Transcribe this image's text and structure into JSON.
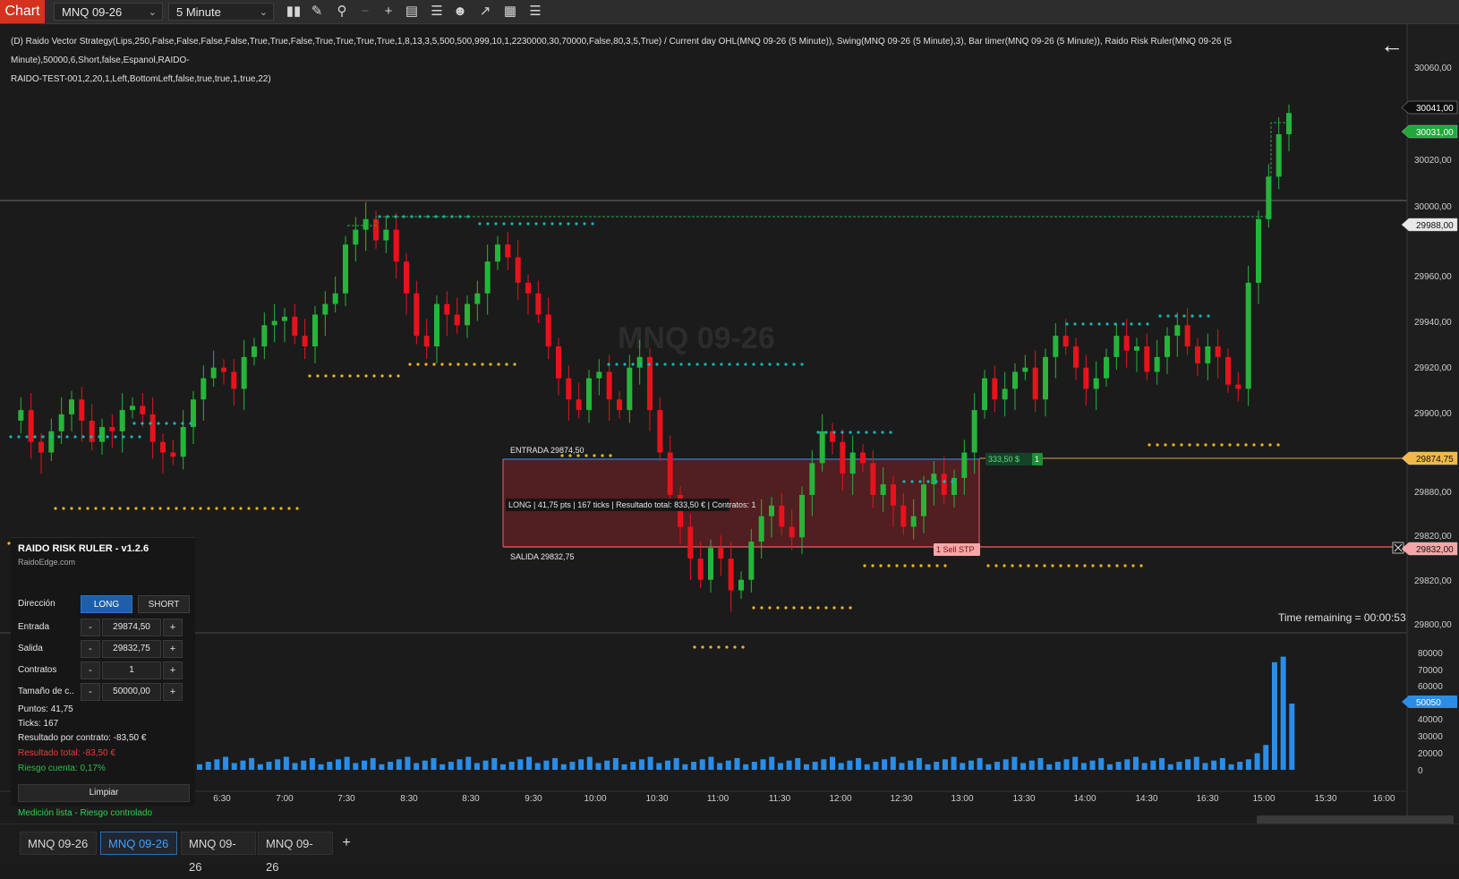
{
  "toolbar": {
    "chart_label": "Chart",
    "instrument": "MNQ 09-26",
    "interval": "5 Minute",
    "icons": [
      "bar-style-icon",
      "draw-pencil-icon",
      "zoom-icon",
      "line-icon",
      "crosshair-icon",
      "data-box-icon",
      "strategy-icon",
      "people-icon",
      "indicator-icon",
      "properties-icon",
      "list-icon"
    ]
  },
  "chart": {
    "indicator_line1": "(D) Raido Vector Strategy(Lips,250,False,False,False,False,True,True,False,True,True,True,True,1,8,13,3,5,500,500,999,10,1,2230000,30,70000,False,80,3,5,True) / Current day OHL(MNQ 09-26 (5 Minute)), Swing(MNQ 09-26 (5 Minute),3), Bar timer(MNQ 09-26 (5 Minute)), Raido Risk Ruler(MNQ 09-26 (5 Minute),50000,6,Short,false,Espanol,RAIDO-",
    "indicator_line2": "RAIDO-TEST-001,2,20,1,Left,BottomLeft,false,true,true,1,true,22)",
    "watermark": "MNQ 09-26",
    "time_remaining": "Time remaining = 00:00:53",
    "entry_label": "ENTRADA  29874,50",
    "exit_label": "SALIDA  29832,75",
    "trade_summary": "LONG | 41,75 pts | 167 ticks | Resultado total: 833,50 € | Contratos: 1",
    "pnl_badge": "333,50 $",
    "qty_badge": "1",
    "order_label": "1  Sell STP",
    "price_axis": [
      "30060,00",
      "30020,00",
      "30000,00",
      "29960,00",
      "29940,00",
      "29920,00",
      "29900,00",
      "29880,00",
      "29820,00",
      "29820,00",
      "29800,00"
    ],
    "price_badges": [
      {
        "text": "30041,00",
        "color": "#0e0e0e",
        "fg": "#ffffff",
        "price": 30041
      },
      {
        "text": "30031,00",
        "color": "#22a83a",
        "fg": "#ffffff",
        "price": 30031
      },
      {
        "text": "29988,00",
        "color": "#e8e8e8",
        "fg": "#111111",
        "price": 29988
      },
      {
        "text": "29874,75",
        "color": "#f2b84b",
        "fg": "#111111",
        "price": 29874.75
      },
      {
        "text": "29832,00",
        "color": "#f5a7a7",
        "fg": "#111111",
        "price": 29832
      }
    ],
    "volume_axis": [
      "80000",
      "70000",
      "60000",
      "40000",
      "30000",
      "20000",
      "0"
    ],
    "volume_badge": "50050",
    "time_axis": [
      "6:30",
      "7:00",
      "7:30",
      "8:30",
      "8:30",
      "9:30",
      "10:00",
      "10:30",
      "11:00",
      "11:30",
      "12:00",
      "12:30",
      "13:00",
      "13:30",
      "14:00",
      "14:30",
      "16:30",
      "15:00",
      "15:30",
      "16:00"
    ],
    "colors": {
      "up": "#26b53a",
      "down": "#e8121c",
      "volume": "#2b8de6",
      "cyan_dots": "#17b5b8",
      "yellow_dots": "#f0b429",
      "entry_line": "#2f7fdc",
      "exit_line": "#f06060",
      "zone_fill": "#5b1e22"
    }
  },
  "panel": {
    "title": "RAIDO RISK RULER - v1.2.6",
    "subtitle": "RaidoEdge.com",
    "direction_label": "Dirección",
    "long_label": "LONG",
    "short_label": "SHORT",
    "fields": [
      {
        "label": "Entrada",
        "value": "29874,50"
      },
      {
        "label": "Salida",
        "value": "29832,75"
      },
      {
        "label": "Contratos",
        "value": "1"
      },
      {
        "label": "Tamaño de c..",
        "value": "50000,00"
      }
    ],
    "minus": "-",
    "plus": "+",
    "points": "Puntos: 41,75",
    "ticks": "Ticks: 167",
    "per_contract": "Resultado por contrato: -83,50 €",
    "total": "Resultado total: -83,50 €",
    "risk": "Riesgo cuenta: 0,17%",
    "clear_label": "Limpiar",
    "status": "Medición lista - Riesgo controlado"
  },
  "tabs": [
    {
      "label": "MNQ 09-26",
      "active": false
    },
    {
      "label": "MNQ 09-26",
      "active": true
    },
    {
      "label": "MNQ 09-26",
      "active": false
    },
    {
      "label": "MNQ 09-26",
      "active": false
    }
  ],
  "tab_add": "+"
}
